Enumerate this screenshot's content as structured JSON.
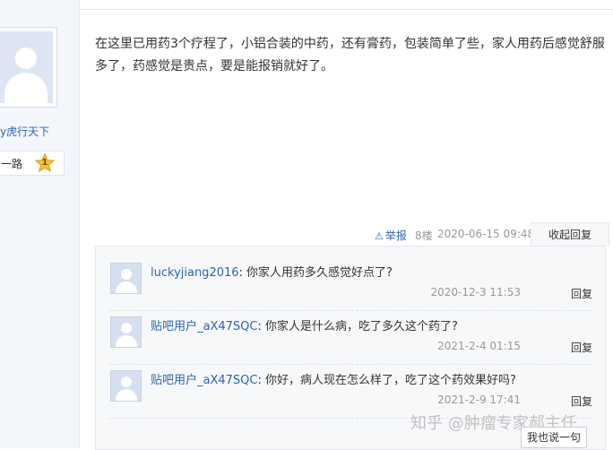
{
  "author": {
    "username": "y虎行天下",
    "level_name": "一路",
    "level_number": "1"
  },
  "post": {
    "content": "在这里已用药3个疗程了，小铝合装的中药，还有膏药，包装简单了些，家人用药后感觉舒服多了，药感觉是贵点，要是能报销就好了。",
    "report_label": "举报",
    "floor": "8楼",
    "date": "2020-06-15 09:48",
    "collapse_label": "收起回复"
  },
  "replies": [
    {
      "name": "luckyjiang2016",
      "text": ": 你家人用药多久感觉好点了?",
      "time": "2020-12-3 11:53",
      "reply_label": "回复"
    },
    {
      "name": "贴吧用户_aX47SQC",
      "text": ": 你家人是什么病，吃了多久这个药了?",
      "time": "2021-2-4 01:15",
      "reply_label": "回复"
    },
    {
      "name": "贴吧用户_aX47SQC",
      "text": ": 你好，病人现在怎么样了，吃了这个药效果好吗?",
      "time": "2021-2-9 17:41",
      "reply_label": "回复"
    }
  ],
  "say_button": "我也说一句",
  "watermark": "知乎 @肿瘤专家郝主任"
}
